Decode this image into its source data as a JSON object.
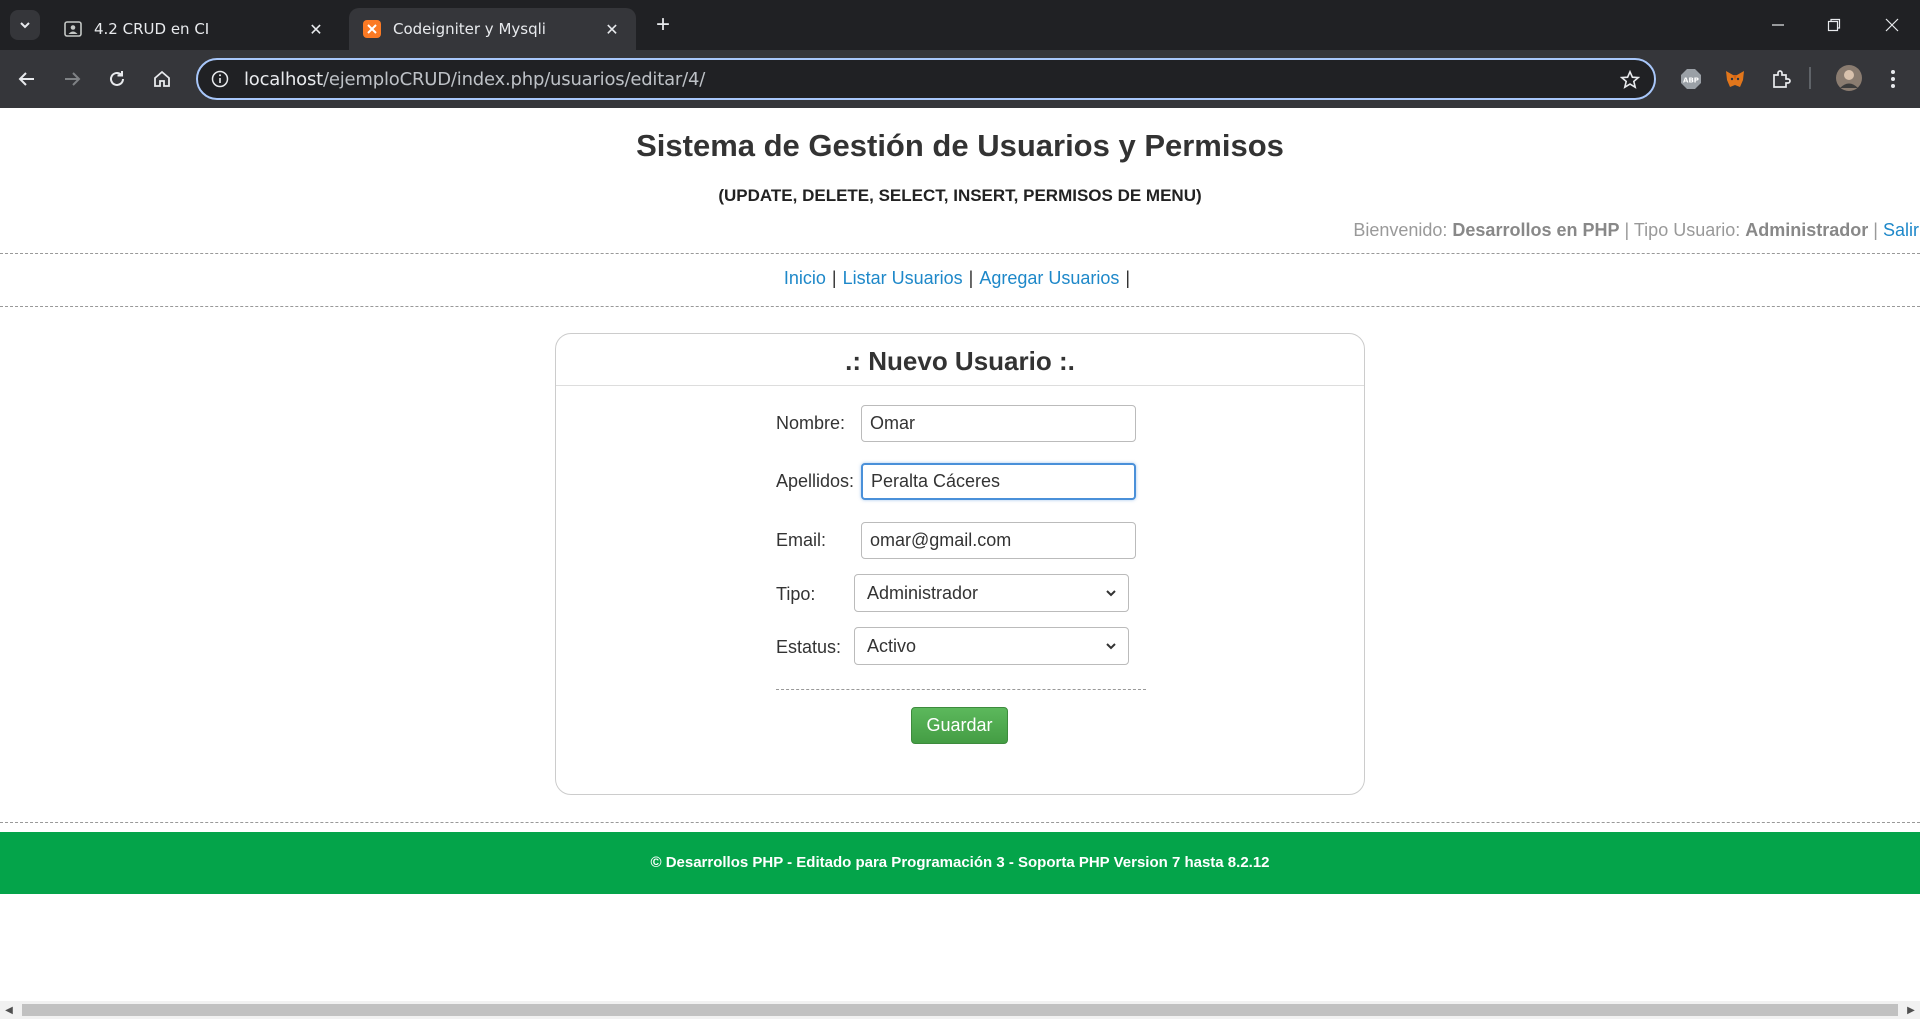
{
  "browser": {
    "tabs": [
      {
        "title": "4.2 CRUD en CI",
        "active": false,
        "icon": "contact-card-icon"
      },
      {
        "title": "Codeigniter y Mysqli",
        "active": true,
        "icon": "xampp-icon"
      }
    ],
    "url_host": "localhost",
    "url_path": "/ejemploCRUD/index.php/usuarios/editar/4/"
  },
  "header": {
    "title": "Sistema de Gestión de Usuarios y Permisos",
    "subtitle": "(UPDATE, DELETE, SELECT, INSERT, PERMISOS DE MENU)",
    "welcome_label": "Bienvenido:",
    "user_name": "Desarrollos en PHP",
    "separator": "|",
    "type_label": "Tipo Usuario:",
    "user_type": "Administrador",
    "logout": "Salir"
  },
  "menu": {
    "items": [
      "Inicio",
      "Listar Usuarios",
      "Agregar Usuarios"
    ],
    "separator": "|"
  },
  "form": {
    "title": ".: Nuevo Usuario :.",
    "nombre_label": "Nombre:",
    "nombre_value": "Omar",
    "apellidos_label": "Apellidos:",
    "apellidos_value": "Peralta Cáceres",
    "email_label": "Email:",
    "email_value": "omar@gmail.com",
    "tipo_label": "Tipo:",
    "tipo_value": "Administrador",
    "estatus_label": "Estatus:",
    "estatus_value": "Activo",
    "save_label": "Guardar"
  },
  "footer": {
    "text": "© Desarrollos PHP - Editado para Programación 3 - Soporta PHP Version 7 hasta 8.2.12"
  },
  "colors": {
    "footer_bg": "#04a44a",
    "link": "#1e88c9",
    "save_button": "#5cb85c"
  }
}
